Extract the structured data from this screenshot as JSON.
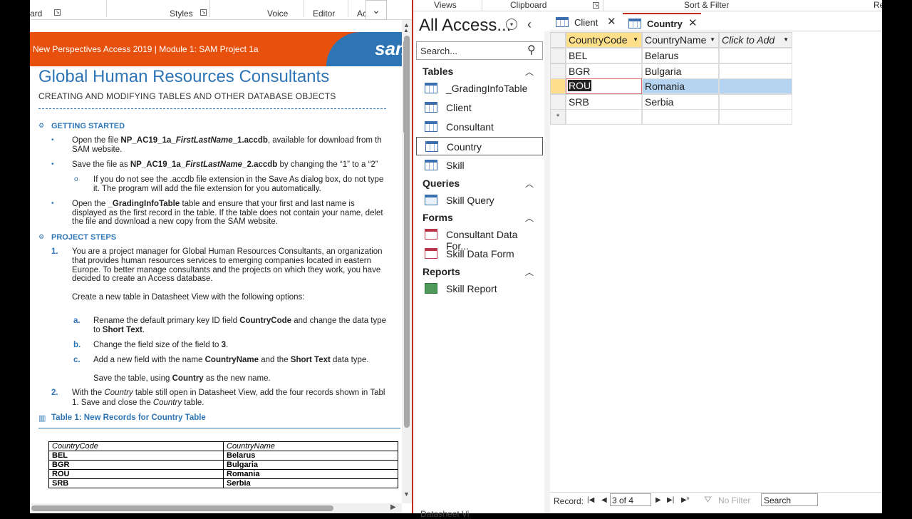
{
  "word": {
    "ribbon": {
      "item_board": "ard",
      "item_styles": "Styles",
      "item_voice": "Voice",
      "item_editor": "Editor",
      "item_ac": "Ac",
      "collapse_icon": "chevron-down-icon"
    },
    "banner": {
      "text": "New Perspectives Access 2019 | Module 1: SAM Project 1a",
      "logo": "sam"
    },
    "title": "Global Human Resources Consultants",
    "subtitle": "CREATING AND MODIFYING TABLES AND OTHER DATABASE OBJECTS",
    "getting_started": {
      "heading": "GETTING STARTED",
      "b1_line1_pre": "Open the file ",
      "b1_line1_file": "NP_AC19_1a_",
      "b1_line1_file_it": "FirstLastName",
      "b1_line1_file_end": "_1.accdb",
      "b1_line1_post": ", available for download from th",
      "b1_line2": "SAM website.",
      "b2_pre": "Save the file as ",
      "b2_file": "NP_AC19_1a_",
      "b2_file_it": "FirstLastName",
      "b2_file_end": "_2.accdb",
      "b2_post": " by changing the “1” to a “2”",
      "sub_line1": "If you do not see the .accdb file extension in the Save As dialog box, do not type",
      "sub_line2": "it. The program will add the file extension for you automatically.",
      "b3_pre": "Open the ",
      "b3_table": "_GradingInfoTable",
      "b3_post": " table and ensure that your first and last name is",
      "b3_line2": "displayed as the first record in the table. If the table does not contain your name, delet",
      "b3_line3": "the file and download a new copy from the SAM website."
    },
    "project_steps": {
      "heading": "PROJECT STEPS",
      "s1_num": "1.",
      "s1_line1": "You are a project manager for Global Human Resources Consultants, an organization",
      "s1_line2": "that provides human resources services to emerging companies located in eastern",
      "s1_line3": "Europe. To better manage consultants and the projects on which they work, you have",
      "s1_line4": "decided to create an Access database.",
      "s1_line5": "Create a new table in Datasheet View with the following options:",
      "a_num": "a.",
      "a_pre": "Rename the default primary key ID field ",
      "a_b1": "CountryCode",
      "a_post": " and change the data type",
      "a_line2_pre": "to ",
      "a_line2_b": "Short Text",
      "a_line2_post": ".",
      "b_num": "b.",
      "b_pre": "Change the field size of the field to ",
      "b_b": "3",
      "b_post": ".",
      "c_num": "c.",
      "c_pre": "Add a new field with the name ",
      "c_b1": "CountryName",
      "c_mid": " and the ",
      "c_b2": "Short Text",
      "c_post": " data type.",
      "save_pre": "Save the table, using ",
      "save_b": "Country",
      "save_post": " as the new name.",
      "s2_num": "2.",
      "s2_pre": "With the ",
      "s2_it": "Country",
      "s2_post": " table still open in Datasheet View, add the four records shown in Tabl",
      "s2_line2_pre": "1. Save and close the ",
      "s2_line2_it": "Country",
      "s2_line2_post": " table."
    },
    "table_caption": "Table 1: New Records for Country Table",
    "records_table": {
      "headers": [
        "CountryCode",
        "CountryName"
      ],
      "rows": [
        [
          "BEL",
          "Belarus"
        ],
        [
          "BGR",
          "Bulgaria"
        ],
        [
          "ROU",
          "Romania"
        ],
        [
          "SRB",
          "Serbia"
        ]
      ]
    }
  },
  "access": {
    "ribbon": {
      "views": "Views",
      "clipboard": "Clipboard",
      "sort_filter": "Sort & Filter",
      "re": "Re"
    },
    "nav": {
      "title": "All Access...",
      "search_placeholder": "Search...",
      "groups": {
        "tables": "Tables",
        "queries": "Queries",
        "forms": "Forms",
        "reports": "Reports"
      },
      "tables": [
        "_GradingInfoTable",
        "Client",
        "Consultant",
        "Country",
        "Skill"
      ],
      "queries": [
        "Skill Query"
      ],
      "forms": [
        "Consultant Data For...",
        "Skill Data Form"
      ],
      "reports": [
        "Skill Report"
      ],
      "selected": "Country"
    },
    "tabs": [
      {
        "label": "Client",
        "icon": "table-icon"
      },
      {
        "label": "Country",
        "icon": "table-icon",
        "active": true
      }
    ],
    "datasheet": {
      "columns": [
        "CountryCode",
        "CountryName",
        "Click to Add"
      ],
      "rows": [
        [
          "BEL",
          "Belarus"
        ],
        [
          "BGR",
          "Bulgaria"
        ],
        [
          "ROU",
          "Romania"
        ],
        [
          "SRB",
          "Serbia"
        ]
      ],
      "new_row_marker": "*",
      "current_row": 3
    },
    "record_nav": {
      "label": "Record:",
      "position": "3 of 4",
      "no_filter": "No Filter",
      "search": "Search"
    },
    "status": "Datasheet Vi"
  },
  "colors": {
    "banner": "#e8500e",
    "title_blue": "#2e75b6",
    "access_red": "#c42b1c",
    "selection": "#b4d4f2"
  }
}
